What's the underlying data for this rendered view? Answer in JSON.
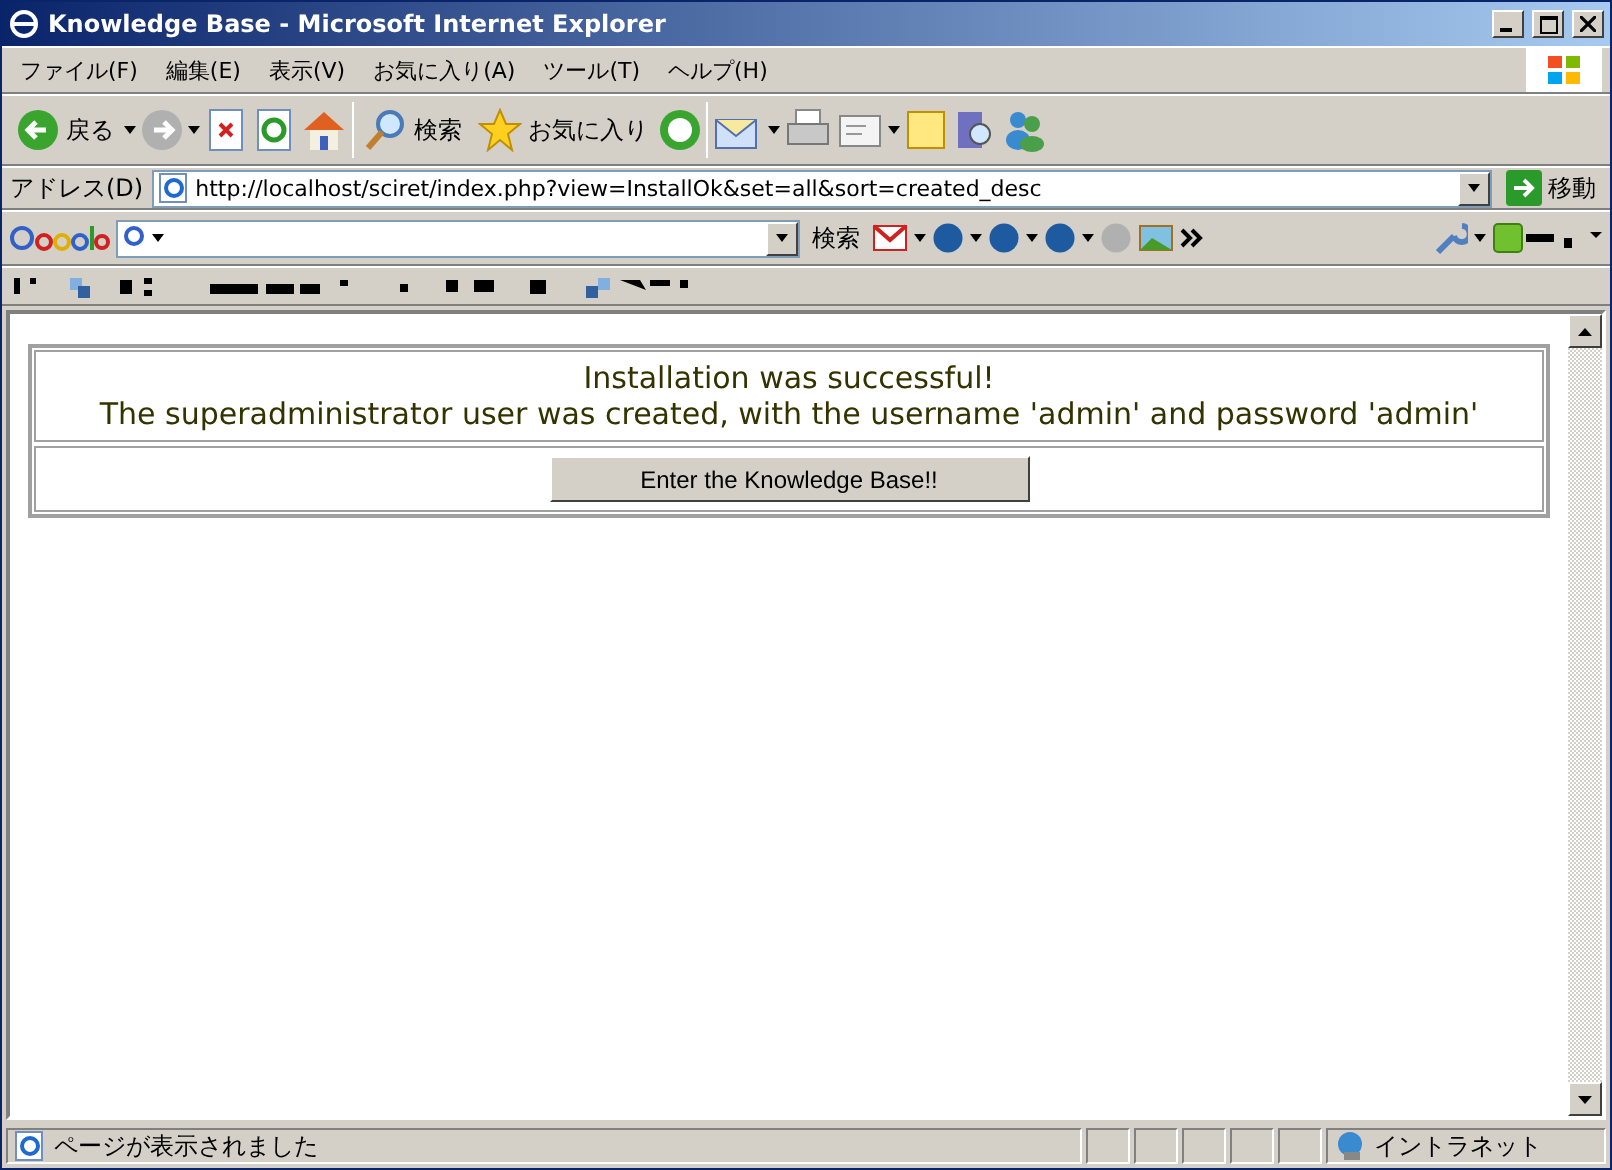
{
  "window": {
    "title": "Knowledge Base - Microsoft Internet Explorer"
  },
  "menu": [
    "ファイル(F)",
    "編集(E)",
    "表示(V)",
    "お気に入り(A)",
    "ツール(T)",
    "ヘルプ(H)"
  ],
  "toolbar": {
    "back": "戻る",
    "search": "検索",
    "favorites": "お気に入り"
  },
  "address": {
    "label": "アドレス(D)",
    "value": "http://localhost/sciret/index.php?view=InstallOk&set=all&sort=created_desc",
    "go": "移動"
  },
  "google_bar": {
    "search": "検索"
  },
  "page": {
    "heading": "Installation was successful!",
    "message": "The superadministrator user was created, with the username 'admin' and password 'admin'",
    "button": "Enter the Knowledge Base!!"
  },
  "status_bar": {
    "text": "ページが表示されました",
    "zone": "イントラネット"
  }
}
